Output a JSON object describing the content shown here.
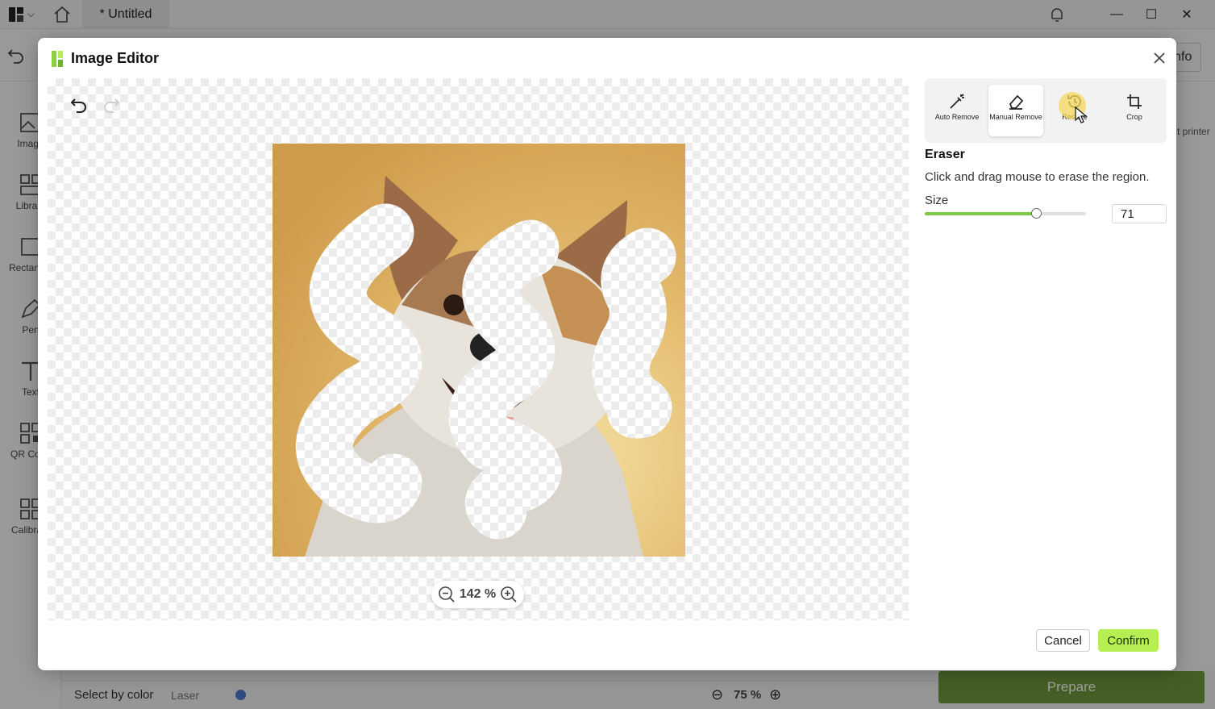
{
  "app": {
    "tab_title": "* Untitled",
    "window_controls": {
      "minimize": "—",
      "maximize": "☐",
      "close": "✕"
    },
    "sidebar": [
      {
        "label": "Image",
        "icon": "image-icon"
      },
      {
        "label": "Library",
        "icon": "library-icon"
      },
      {
        "label": "Rectangle",
        "icon": "rectangle-icon"
      },
      {
        "label": "Pen",
        "icon": "pen-icon"
      },
      {
        "label": "Text",
        "icon": "text-icon"
      },
      {
        "label": "QR Code",
        "icon": "qr-code-icon"
      },
      {
        "label": "Calibrate",
        "icon": "calibrate-icon"
      }
    ],
    "right_peek": {
      "info_label": "Info",
      "printer_label": "Select printer"
    },
    "bottom": {
      "select_label": "Select by color",
      "mode_value": "Laser",
      "zoom_value": "75 %",
      "prepare_label": "Prepare"
    }
  },
  "dialog": {
    "title": "Image Editor",
    "zoom": "142 %",
    "tools": [
      {
        "label": "Auto Remove",
        "icon": "magic-wand-icon",
        "active": false
      },
      {
        "label": "Manual Remove",
        "icon": "eraser-icon",
        "active": true
      },
      {
        "label": "Restore",
        "icon": "restore-icon",
        "active": false
      },
      {
        "label": "Crop",
        "icon": "crop-icon",
        "active": false
      }
    ],
    "section_title": "Eraser",
    "description": "Click and drag mouse to erase the region.",
    "size_label": "Size",
    "size_value": "71",
    "size_slider_fraction": 0.69,
    "cancel_label": "Cancel",
    "confirm_label": "Confirm",
    "colors": {
      "accent": "#b7ef52",
      "slider": "#7ac943",
      "prepare": "#6e9a3c"
    }
  }
}
